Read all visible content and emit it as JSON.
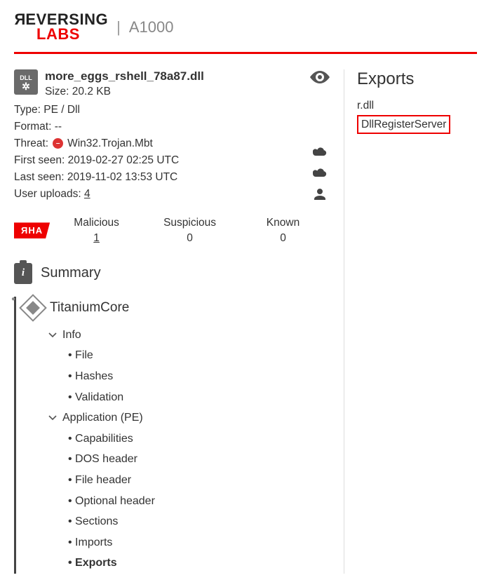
{
  "header": {
    "logo_top": "REVERSING",
    "logo_bottom": "LABS",
    "product": "A1000"
  },
  "file": {
    "badge_label": "DLL",
    "name": "more_eggs_rshell_78a87.dll",
    "size_label": "Size:",
    "size_value": "20.2 KB",
    "type_label": "Type:",
    "type_value": "PE / Dll",
    "format_label": "Format:",
    "format_value": "--",
    "threat_label": "Threat:",
    "threat_value": "Win32.Trojan.Mbt",
    "first_seen_label": "First seen:",
    "first_seen_value": "2019-02-27 02:25 UTC",
    "last_seen_label": "Last seen:",
    "last_seen_value": "2019-11-02 13:53 UTC",
    "user_uploads_label": "User uploads:",
    "user_uploads_value": "4"
  },
  "stats": {
    "badge": "ЯHA",
    "malicious_label": "Malicious",
    "malicious_value": "1",
    "suspicious_label": "Suspicious",
    "suspicious_value": "0",
    "known_label": "Known",
    "known_value": "0"
  },
  "summary": {
    "title": "Summary",
    "core_title": "TitaniumCore",
    "info_group": "Info",
    "info_items": [
      "File",
      "Hashes",
      "Validation"
    ],
    "app_group": "Application (PE)",
    "app_items": [
      "Capabilities",
      "DOS header",
      "File header",
      "Optional header",
      "Sections",
      "Imports",
      "Exports"
    ]
  },
  "exports": {
    "title": "Exports",
    "items": [
      {
        "name": "r.dll",
        "highlighted": false
      },
      {
        "name": "DllRegisterServer",
        "highlighted": true
      }
    ]
  }
}
